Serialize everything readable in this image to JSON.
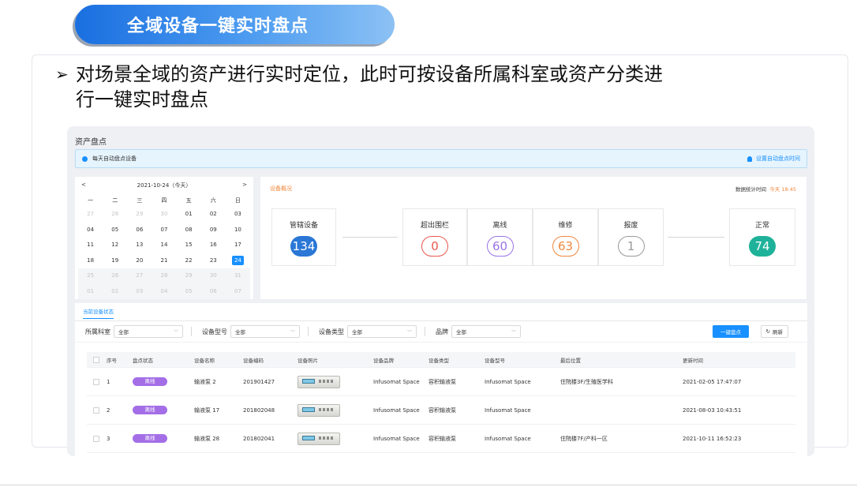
{
  "banner": {
    "title": "全域设备一键实时盘点"
  },
  "bullet": {
    "text": "对场景全域的资产进行实时定位，此时可按设备所属科室或资产分类进行一键实时盘点"
  },
  "app": {
    "page_title": "资产盘点",
    "notice": {
      "text": "每天自动盘点设备",
      "link": "设置自动盘点时间"
    },
    "calendar": {
      "header": "2021-10-24（今天）",
      "prev": "<",
      "next": ">",
      "weekdays": [
        "一",
        "二",
        "三",
        "四",
        "五",
        "六",
        "日"
      ],
      "rows": [
        [
          "27",
          "28",
          "29",
          "30",
          "01",
          "02",
          "03"
        ],
        [
          "04",
          "05",
          "06",
          "07",
          "08",
          "09",
          "10"
        ],
        [
          "11",
          "12",
          "13",
          "14",
          "15",
          "16",
          "17"
        ],
        [
          "18",
          "19",
          "20",
          "21",
          "22",
          "23",
          "24"
        ],
        [
          "25",
          "26",
          "27",
          "28",
          "29",
          "30",
          "31"
        ],
        [
          "01",
          "02",
          "03",
          "04",
          "05",
          "06",
          "07"
        ]
      ],
      "selected": "24"
    },
    "overview": {
      "title": "设备概况",
      "time_label": "数据统计时间",
      "time_value": "今天 18:45",
      "stats": [
        {
          "label": "管辖设备",
          "value": "134",
          "color": "#2a77d6"
        },
        {
          "label": "超出围栏",
          "value": "0",
          "color": "#e8584f"
        },
        {
          "label": "离线",
          "value": "60",
          "color": "#9b73e6"
        },
        {
          "label": "维修",
          "value": "63",
          "color": "#f0883e"
        },
        {
          "label": "报废",
          "value": "1",
          "color": "#9a9a9a"
        },
        {
          "label": "正常",
          "value": "74",
          "color": "#1fb29a"
        }
      ]
    },
    "status": {
      "tab": "当前设备状态",
      "filters": [
        {
          "label": "所属科室",
          "value": "全部"
        },
        {
          "label": "设备型号",
          "value": "全部"
        },
        {
          "label": "设备类型",
          "value": "全部"
        },
        {
          "label": "品牌",
          "value": "全部"
        }
      ],
      "inventory_button": "一键盘点",
      "refresh_button": "刷新",
      "columns": [
        "序号",
        "盘点状态",
        "设备名称",
        "设备编码",
        "设备照片",
        "设备品牌",
        "设备类型",
        "设备型号",
        "最后位置",
        "更新时间"
      ],
      "rows": [
        {
          "idx": "1",
          "status": "离线",
          "name": "输液泵 2",
          "code": "201901427",
          "brand": "Infusomat Space",
          "type": "容积输液泵",
          "model": "Infusomat Space",
          "location": "住院楼3F/生殖医学科",
          "updated": "2021-02-05 17:47:07"
        },
        {
          "idx": "2",
          "status": "离线",
          "name": "输液泵 17",
          "code": "201802048",
          "brand": "Infusomat Space",
          "type": "容积输液泵",
          "model": "Infusomat Space",
          "location": "",
          "updated": "2021-08-03 10:43:51"
        },
        {
          "idx": "3",
          "status": "离线",
          "name": "输液泵 28",
          "code": "201802041",
          "brand": "Infusomat Space",
          "type": "容积输液泵",
          "model": "Infusomat Space",
          "location": "住院楼7F/产科一区",
          "updated": "2021-10-11 16:52:23"
        }
      ]
    }
  }
}
